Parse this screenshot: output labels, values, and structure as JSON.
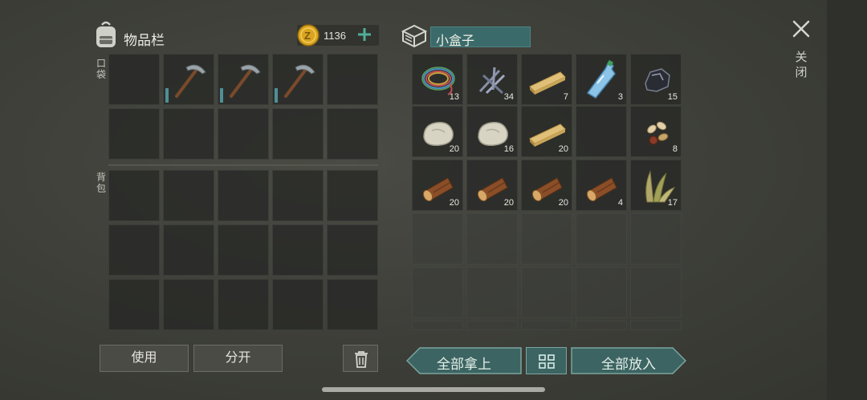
{
  "inventory": {
    "title": "物品栏",
    "coins": "1136",
    "pocket_label": "口袋",
    "backpack_label": "背包",
    "pocket_slots": [
      {
        "item": "",
        "qty": ""
      },
      {
        "item": "pickaxe-icon",
        "qty": ""
      },
      {
        "item": "pickaxe-icon",
        "qty": ""
      },
      {
        "item": "pickaxe-icon",
        "qty": ""
      },
      {
        "item": "",
        "qty": ""
      }
    ]
  },
  "container": {
    "name": "小盒子",
    "items": [
      {
        "icon": "wire-icon",
        "qty": "13"
      },
      {
        "icon": "nails-icon",
        "qty": "34"
      },
      {
        "icon": "plank-icon",
        "qty": "7"
      },
      {
        "icon": "water-bottle-icon",
        "qty": "3"
      },
      {
        "icon": "coal-icon",
        "qty": "15"
      },
      {
        "icon": "stone-icon",
        "qty": "20"
      },
      {
        "icon": "stone-icon",
        "qty": "16"
      },
      {
        "icon": "plank-icon",
        "qty": "20"
      },
      {
        "icon": "",
        "qty": ""
      },
      {
        "icon": "seeds-icon",
        "qty": "8"
      },
      {
        "icon": "log-icon",
        "qty": "20"
      },
      {
        "icon": "log-icon",
        "qty": "20"
      },
      {
        "icon": "log-icon",
        "qty": "20"
      },
      {
        "icon": "log-icon",
        "qty": "4"
      },
      {
        "icon": "plant-fiber-icon",
        "qty": "17"
      }
    ]
  },
  "buttons": {
    "use": "使用",
    "split": "分开",
    "take_all": "全部拿上",
    "put_all": "全部放入",
    "close": "关闭"
  },
  "colors": {
    "accent_teal": "#3c6462",
    "coin_gold": "#d9a520",
    "plus_green": "#4fae9a"
  }
}
